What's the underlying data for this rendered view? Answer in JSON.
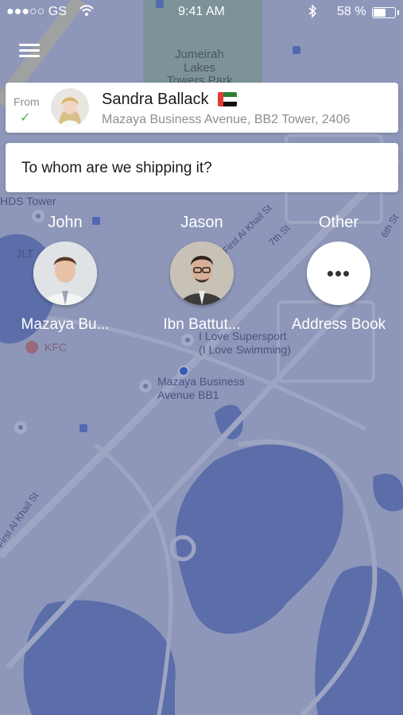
{
  "status_bar": {
    "carrier": "●●●○○ GS",
    "time": "9:41 AM",
    "battery_percent": "58 %",
    "battery_level": 0.58
  },
  "map_labels": {
    "jumeirah": "Jumeirah",
    "lakes": "Lakes",
    "towers_park": "Towers Park",
    "hds_tower": "HDS Tower",
    "jlt": "JLT",
    "kfc": "KFC",
    "i_love_supersport": "I Love Supersport",
    "i_love_swimming": "(I Love Swimming)",
    "mazaya_business": "Mazaya Business",
    "avenue_bb1": "Avenue BB1",
    "first_al_khail_1": "First Al Khail St",
    "first_al_khail_2": "First Al Khail St",
    "seventh_st": "7th St",
    "sixth_st": "6th St"
  },
  "from_card": {
    "label": "From",
    "sender_name": "Sandra Ballack",
    "sender_address": "Mazaya Business Avenue, BB2 Tower, 2406",
    "flag_colors": {
      "red": "#e53935",
      "green": "#2e7d32",
      "white": "#ffffff",
      "black": "#111111"
    }
  },
  "question_card": {
    "text": "To whom are we shipping it?"
  },
  "recipients": [
    {
      "name": "John",
      "subtitle": "Mazaya Bu...",
      "type": "photo"
    },
    {
      "name": "Jason",
      "subtitle": "Ibn Battut...",
      "type": "photo"
    },
    {
      "name": "Other",
      "subtitle": "Address Book",
      "type": "more",
      "icon": "•••"
    }
  ],
  "colors": {
    "overlay": "#46528c",
    "accent_green": "#4caf50"
  }
}
